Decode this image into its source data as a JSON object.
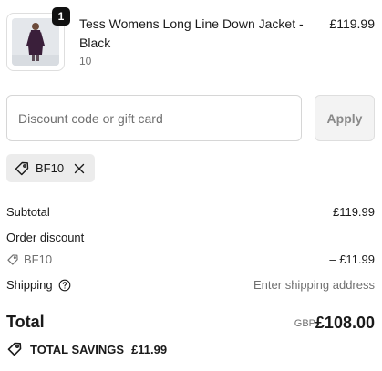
{
  "product": {
    "quantity": "1",
    "name": "Tess Womens Long Line Down Jacket - Black",
    "variant": "10",
    "price": "£119.99",
    "image_icon": "product-photo-jacket"
  },
  "discount": {
    "placeholder": "Discount code or gift card",
    "value": "",
    "apply_label": "Apply",
    "applied_code": "BF10"
  },
  "summary": {
    "subtotal_label": "Subtotal",
    "subtotal_value": "£119.99",
    "order_discount_label": "Order discount",
    "discount_code": "BF10",
    "discount_value": "– £11.99",
    "shipping_label": "Shipping",
    "shipping_value": "Enter shipping address",
    "total_label": "Total",
    "currency": "GBP",
    "total_value": "£108.00",
    "savings_label": "TOTAL SAVINGS",
    "savings_value": "£11.99"
  },
  "colors": {
    "text": "#1a1a1a",
    "muted": "#707070",
    "border": "#d6d6d6",
    "tag_bg": "#ececec",
    "badge_bg": "#111111"
  }
}
